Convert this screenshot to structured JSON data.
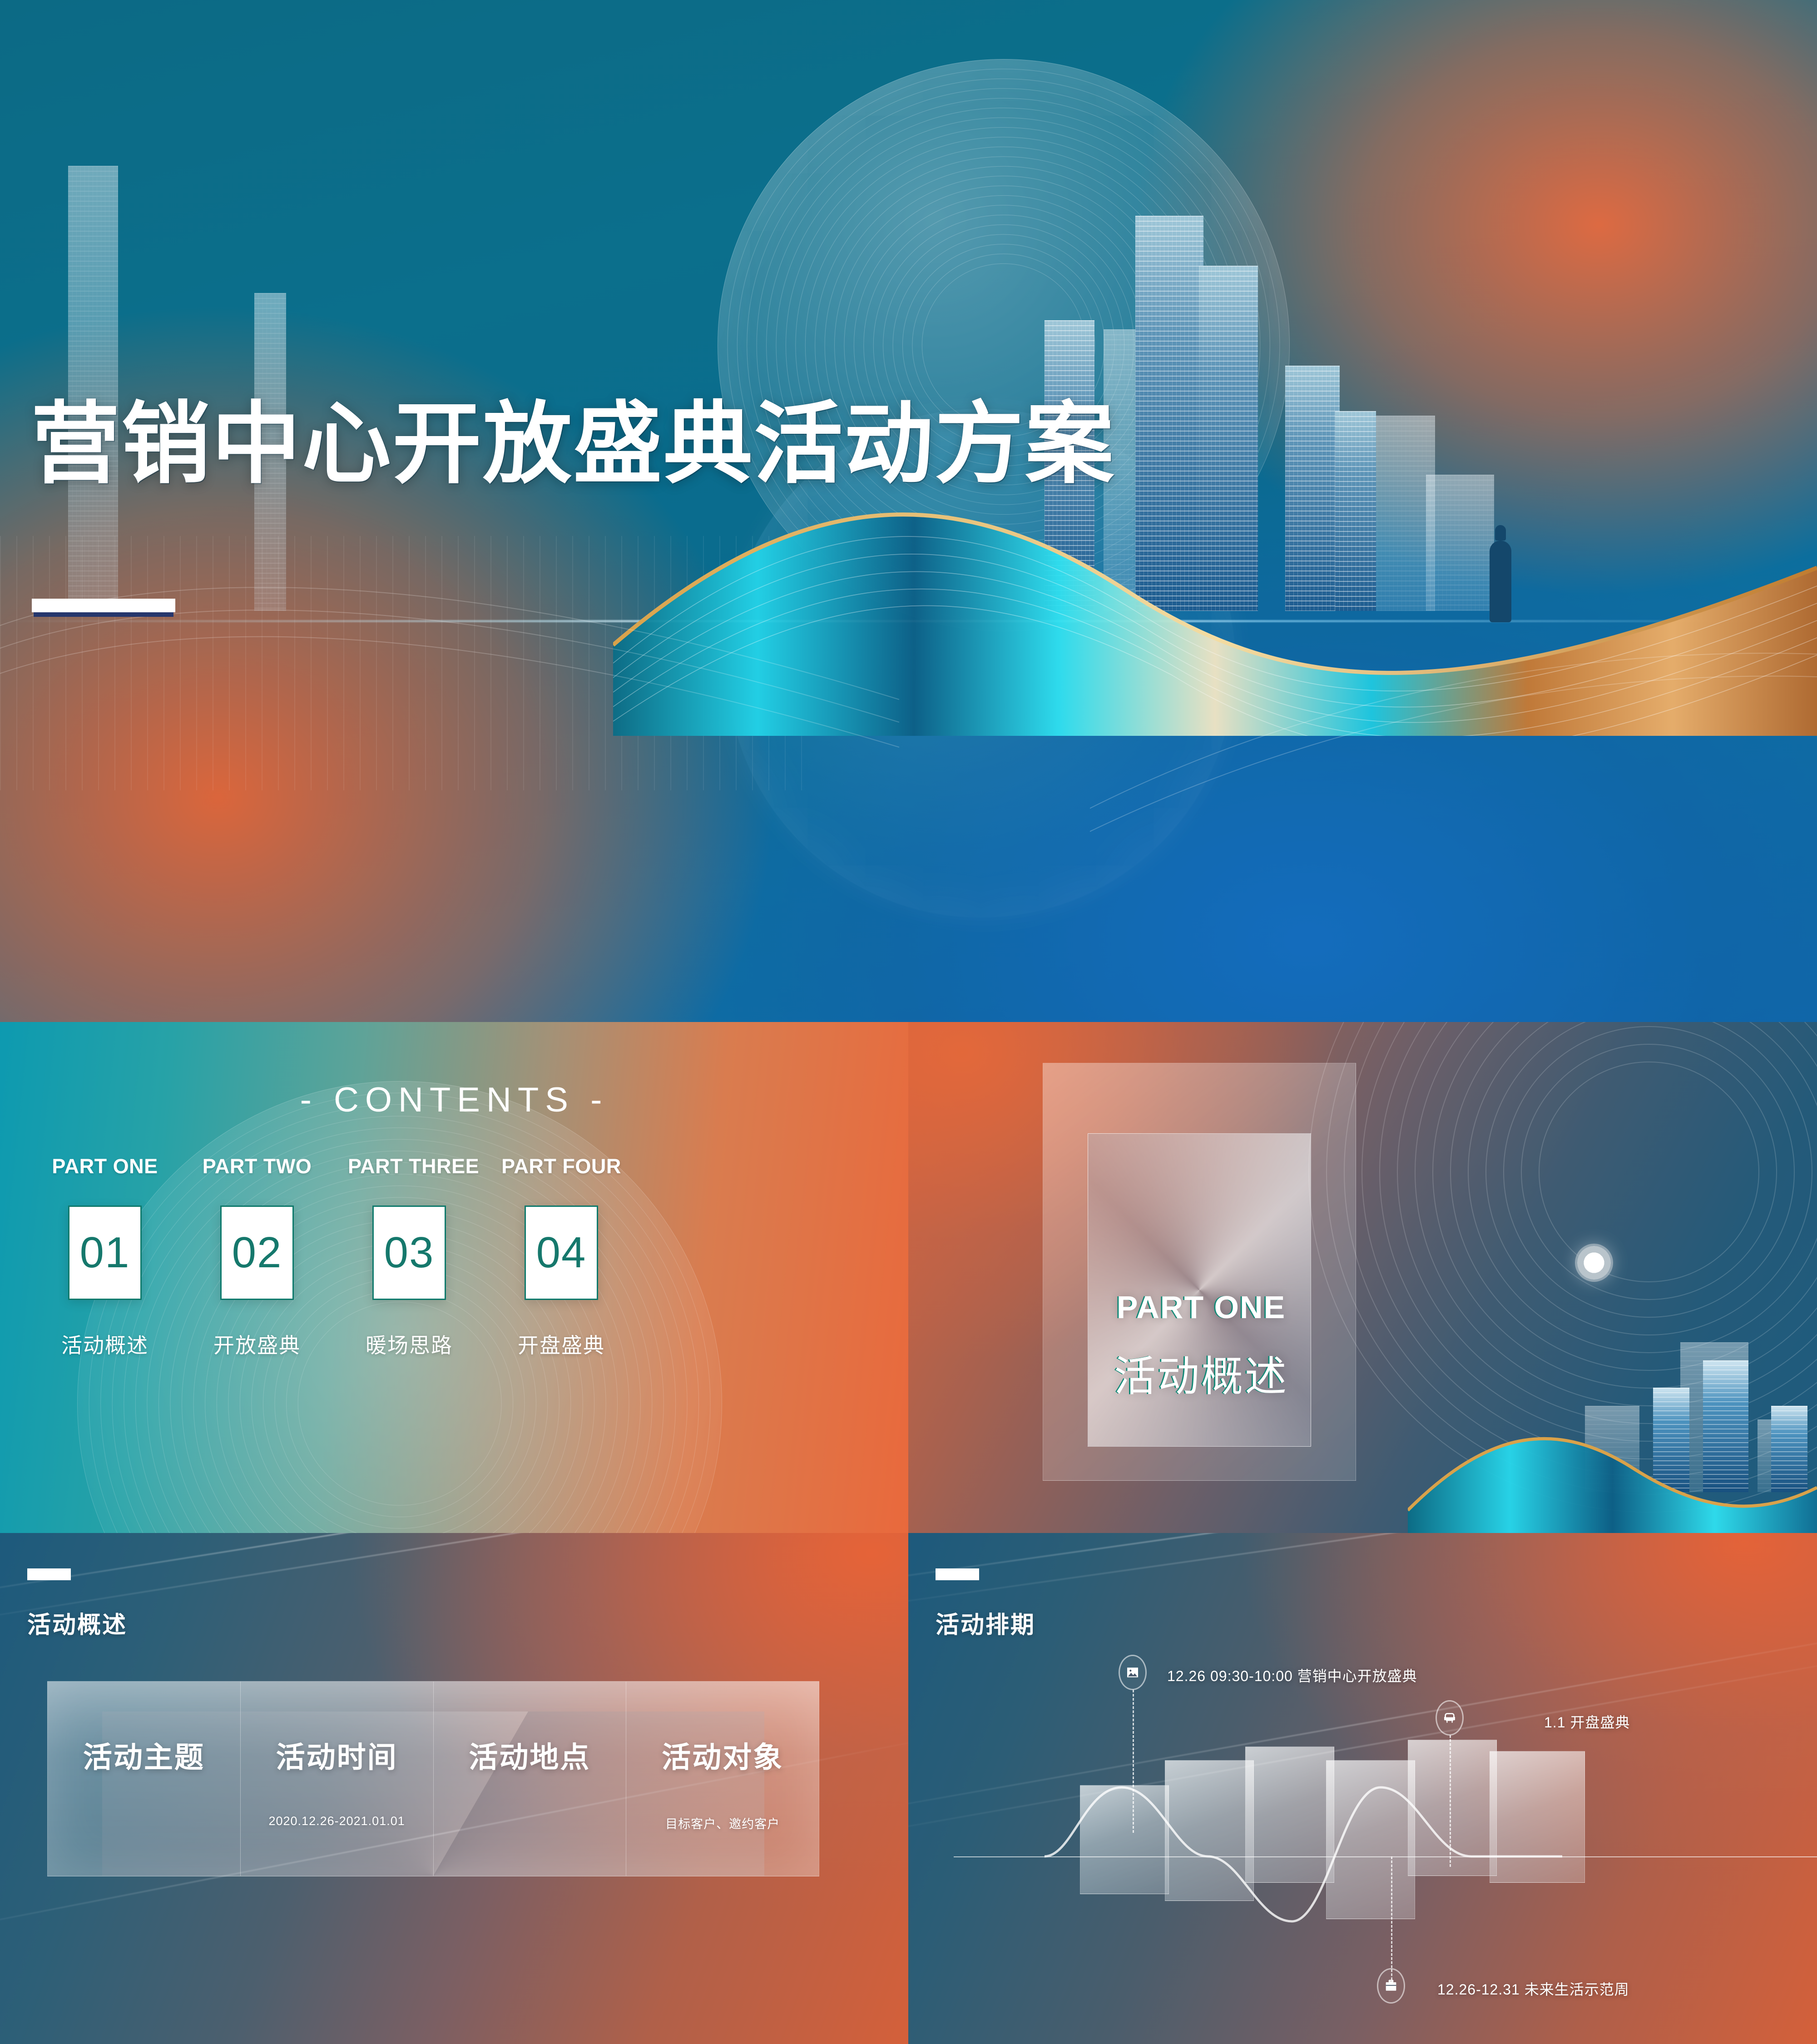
{
  "hero": {
    "title": "营销中心开放盛典活动方案"
  },
  "contents": {
    "title": "- CONTENTS -",
    "parts": [
      {
        "label": "PART ONE",
        "number": "01",
        "subtitle": "活动概述"
      },
      {
        "label": "PART TWO",
        "number": "02",
        "subtitle": "开放盛典"
      },
      {
        "label": "PART THREE",
        "number": "03",
        "subtitle": "暖场思路"
      },
      {
        "label": "PART FOUR",
        "number": "04",
        "subtitle": "开盘盛典"
      }
    ]
  },
  "part_one": {
    "label_en": "PART ONE",
    "label_cn": "活动概述"
  },
  "overview": {
    "heading": "活动概述",
    "cells": [
      {
        "title": "活动主题",
        "value": ""
      },
      {
        "title": "活动时间",
        "value": "2020.12.26-2021.01.01"
      },
      {
        "title": "活动地点",
        "value": ""
      },
      {
        "title": "活动对象",
        "value": "目标客户、邀约客户"
      }
    ]
  },
  "timeline": {
    "heading": "活动排期",
    "items": [
      {
        "icon": "image-icon",
        "label": "12.26 09:30-10:00  营销中心开放盛典"
      },
      {
        "icon": "armchair-icon",
        "label": "1.1 开盘盛典"
      },
      {
        "icon": "briefcase-icon",
        "label": "12.26-12.31  未来生活示范周"
      }
    ]
  },
  "colors": {
    "teal": "#15786c",
    "orange": "#e3653c",
    "blue": "#0f69a8",
    "white": "#ffffff"
  }
}
